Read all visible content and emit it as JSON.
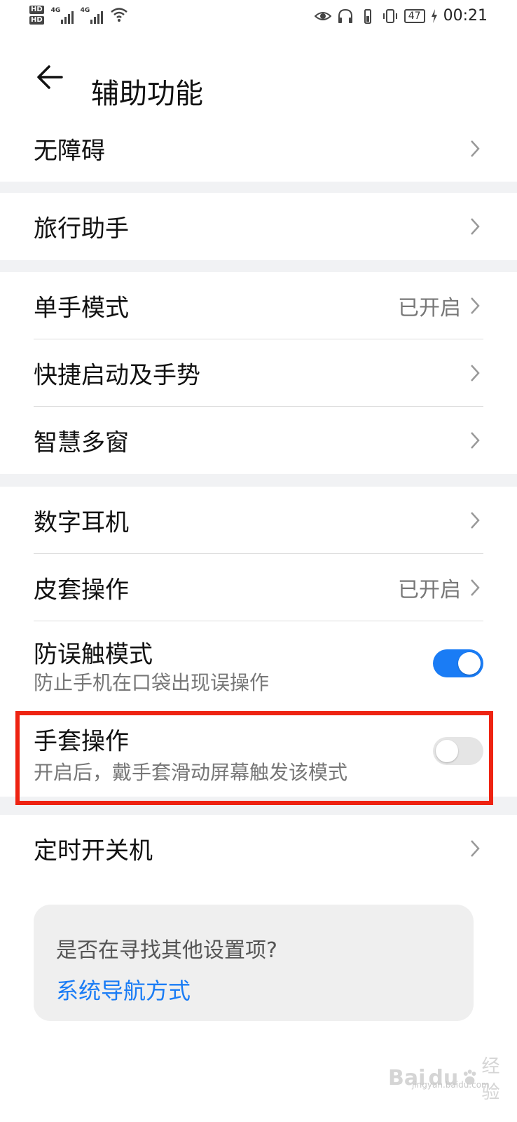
{
  "status_bar": {
    "hd1": "HD",
    "hd2": "HD",
    "sim1_net": "4G",
    "sim2_net": "4G",
    "battery": "47",
    "time": "00:21"
  },
  "header": {
    "title": "辅助功能"
  },
  "groups": [
    {
      "items": [
        {
          "label": "无障碍"
        }
      ]
    },
    {
      "items": [
        {
          "label": "旅行助手"
        }
      ]
    },
    {
      "items": [
        {
          "label": "单手模式",
          "value": "已开启"
        },
        {
          "label": "快捷启动及手势"
        },
        {
          "label": "智慧多窗"
        }
      ]
    },
    {
      "items": [
        {
          "label": "数字耳机"
        },
        {
          "label": "皮套操作",
          "value": "已开启"
        },
        {
          "label": "防误触模式",
          "sub": "防止手机在口袋出现误操作",
          "toggle": true
        },
        {
          "label": "手套操作",
          "sub": "开启后，戴手套滑动屏幕触发该模式",
          "toggle": false
        }
      ]
    },
    {
      "items": [
        {
          "label": "定时开关机"
        }
      ]
    }
  ],
  "suggest": {
    "question": "是否在寻找其他设置项?",
    "link": "系统导航方式"
  },
  "watermark": {
    "brand": "Bai",
    "brand_accent": "du",
    "brand_cn": "经验",
    "url": "jingyan.baidu.com"
  },
  "colors": {
    "accent": "#1a7cf5",
    "highlight": "#ee2312",
    "background": "#f1f2f4"
  }
}
